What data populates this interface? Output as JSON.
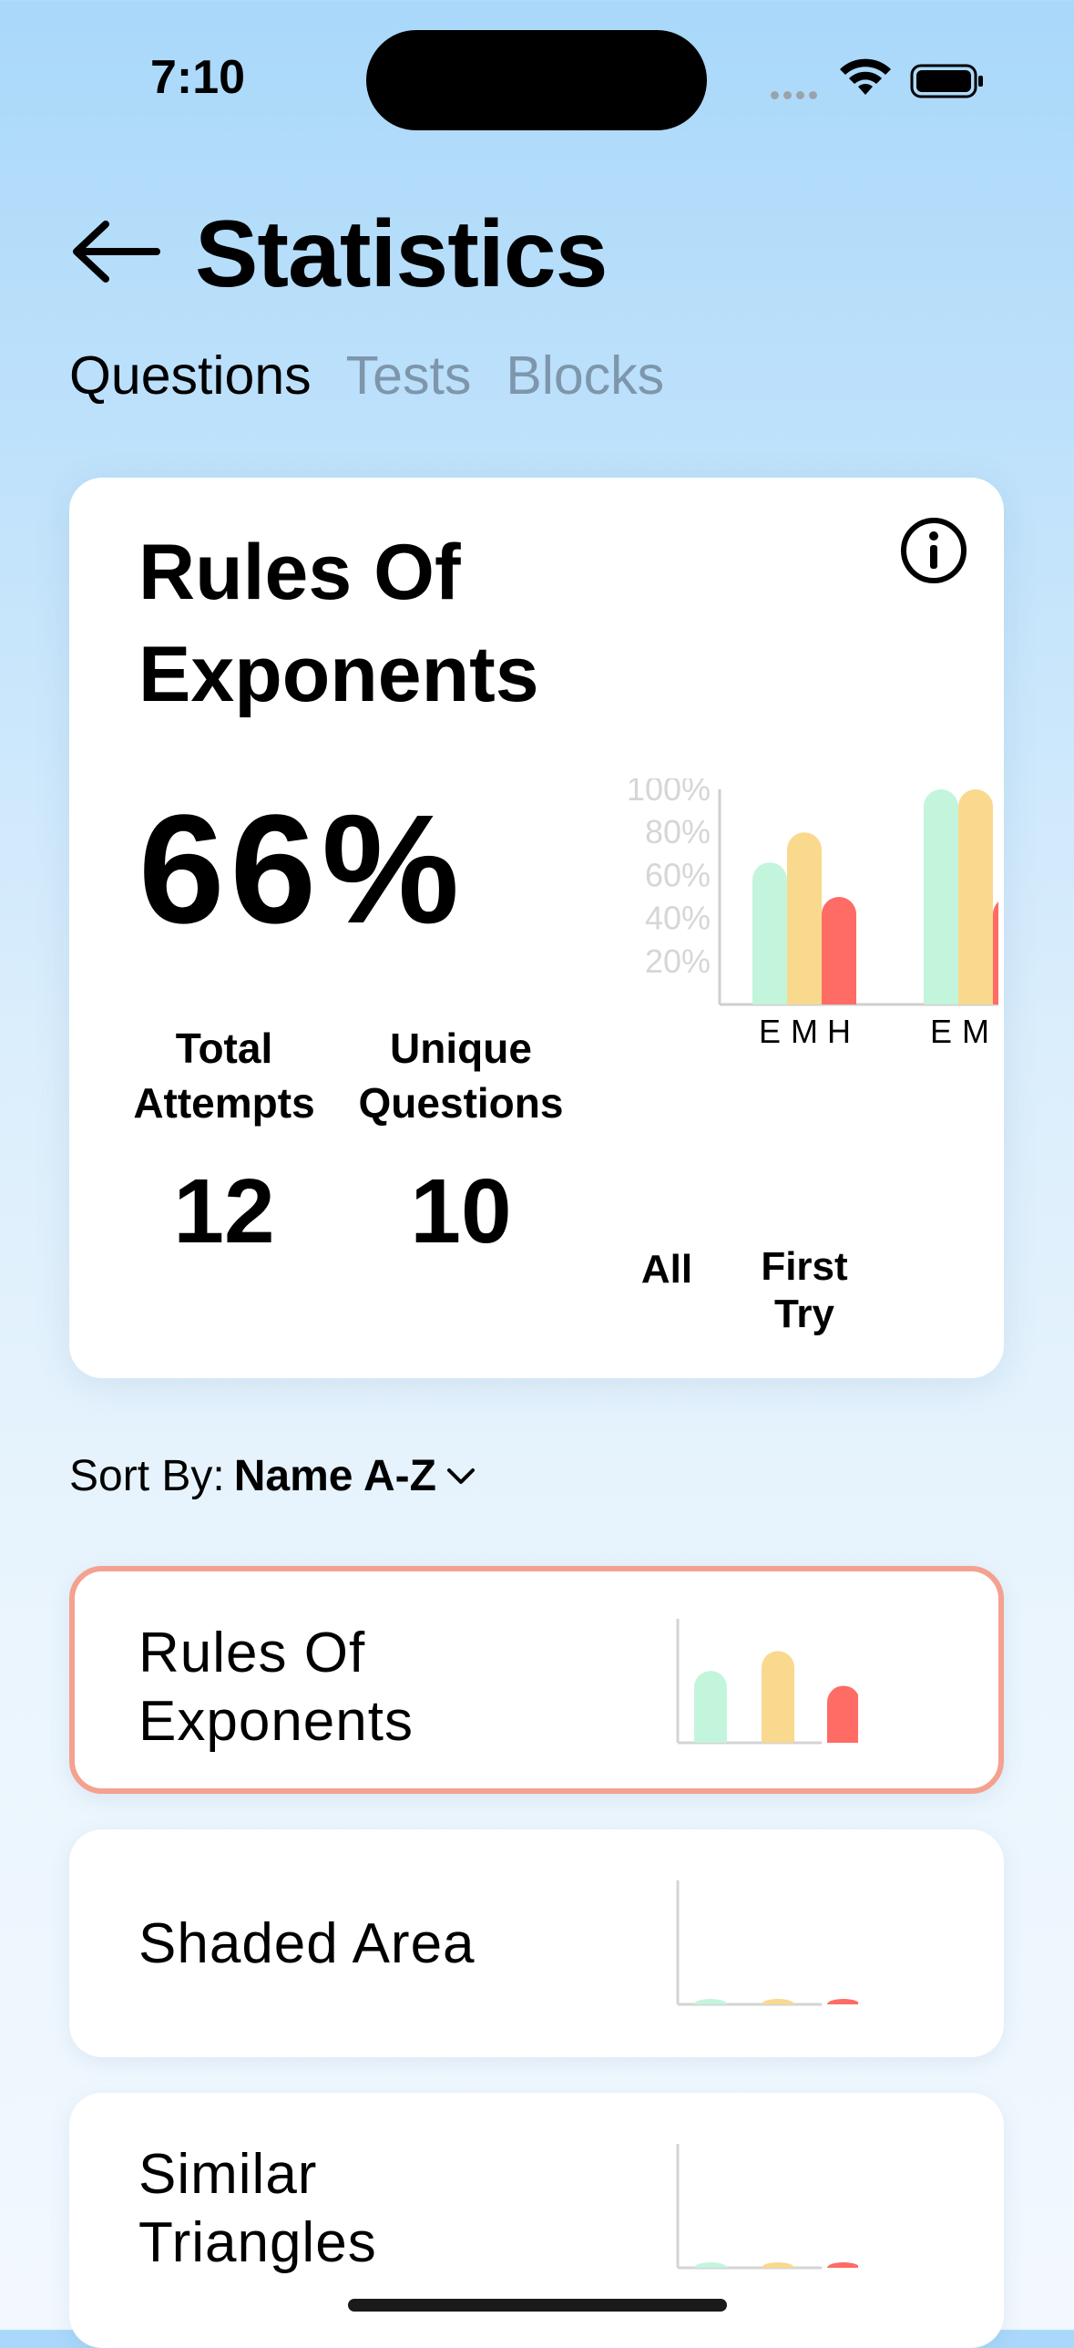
{
  "status_bar": {
    "time": "7:10"
  },
  "header": {
    "title": "Statistics",
    "tabs": [
      {
        "label": "Questions",
        "active": true
      },
      {
        "label": "Tests",
        "active": false
      },
      {
        "label": "Blocks",
        "active": false
      }
    ]
  },
  "summary": {
    "title_line1": "Rules Of",
    "title_line2": "Exponents",
    "percent": "66%",
    "total_attempts_label_1": "Total",
    "total_attempts_label_2": "Attempts",
    "total_attempts_value": "12",
    "unique_questions_label_1": "Unique",
    "unique_questions_label_2": "Questions",
    "unique_questions_value": "10",
    "groups": [
      {
        "label_1": "All",
        "label_2": ""
      },
      {
        "label_1": "First",
        "label_2": "Try"
      }
    ]
  },
  "sort": {
    "prefix": "Sort By:",
    "value": "Name A-Z"
  },
  "list": [
    {
      "name_line1": "Rules Of",
      "name_line2": "Exponents",
      "selected": true
    },
    {
      "name_line1": "Shaded Area",
      "name_line2": "",
      "selected": false
    },
    {
      "name_line1": "Similar",
      "name_line2": "Triangles",
      "selected": false
    }
  ],
  "colors": {
    "easy": "#c3f5dc",
    "medium": "#f9d98d",
    "hard": "#ff6b65",
    "selected_border": "#f4a190"
  },
  "chart_data": {
    "type": "bar",
    "groups": [
      "All",
      "First Try"
    ],
    "categories": [
      "E",
      "M",
      "H"
    ],
    "series": [
      {
        "group": "All",
        "values": [
          66,
          80,
          50
        ]
      },
      {
        "group": "First Try",
        "values": [
          100,
          100,
          50
        ]
      }
    ],
    "yticks": [
      "20%",
      "40%",
      "60%",
      "80%",
      "100%"
    ],
    "ylim": [
      0,
      100
    ]
  },
  "mini_charts": [
    {
      "values": [
        0.58,
        0.74,
        0.46
      ]
    },
    {
      "values": [
        0.02,
        0.02,
        0.02
      ]
    },
    {
      "values": [
        0.02,
        0.02,
        0.02
      ]
    }
  ]
}
